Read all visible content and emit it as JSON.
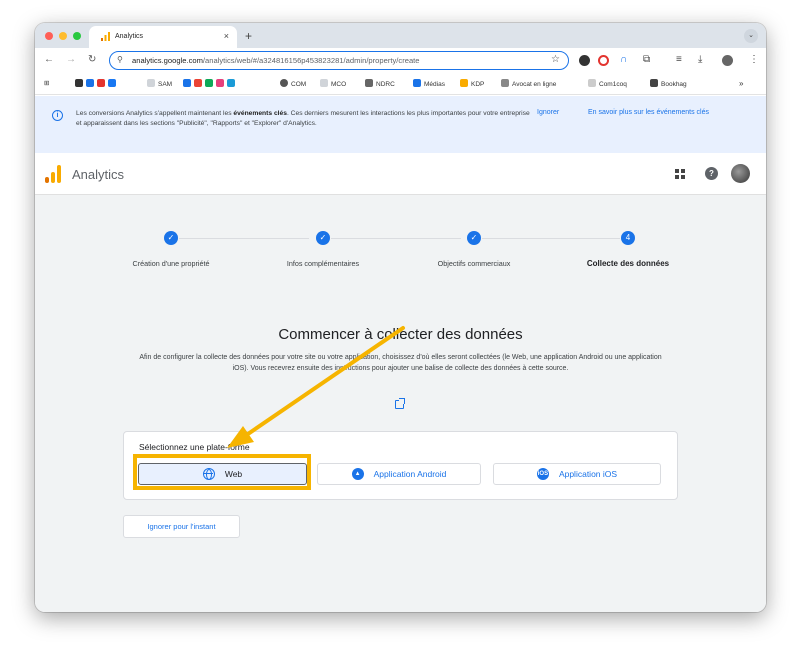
{
  "browser": {
    "tab_title": "Analytics",
    "tab_close": "×",
    "new_tab": "+",
    "url_host": "analytics.google.com",
    "url_path": "/analytics/web/#/a324816156p453823281/admin/property/create",
    "bookmarks": [
      "SAM",
      "COM",
      "MCO",
      "NDRC",
      "Médias",
      "KDP",
      "Avocat en ligne",
      "Com1coq",
      "Bookhag"
    ],
    "overflow": "»"
  },
  "banner": {
    "text_before": "Les conversions Analytics s'appellent maintenant les ",
    "text_bold": "événements clés",
    "text_after": ". Ces derniers mesurent les interactions les plus importantes pour votre entreprise et apparaissent dans les sections \"Publicité\", \"Rapports\" et \"Explorer\" d'Analytics.",
    "dismiss": "Ignorer",
    "learn_more": "En savoir plus sur les événements clés"
  },
  "app": {
    "name": "Analytics",
    "help": "?"
  },
  "stepper": {
    "steps": [
      {
        "label": "Création d'une propriété",
        "mark": "✓"
      },
      {
        "label": "Infos complémentaires",
        "mark": "✓"
      },
      {
        "label": "Objectifs commerciaux",
        "mark": "✓"
      },
      {
        "label": "Collecte des données",
        "mark": "4"
      }
    ]
  },
  "main": {
    "heading": "Commencer à collecter des données",
    "description": "Afin de configurer la collecte des données pour votre site ou votre application, choisissez d'où elles seront collectées (le Web, une application Android ou une application iOS). Vous recevrez ensuite des instructions pour ajouter une balise de collecte des données à cette source.",
    "platform_title": "Sélectionnez une plate-forme",
    "platforms": {
      "web": "Web",
      "android": "Application Android",
      "ios": "Application iOS",
      "ios_badge": "iOS"
    },
    "skip": "Ignorer pour l'instant"
  },
  "colors": {
    "accent": "#1a73e8",
    "highlight": "#f6b400"
  }
}
